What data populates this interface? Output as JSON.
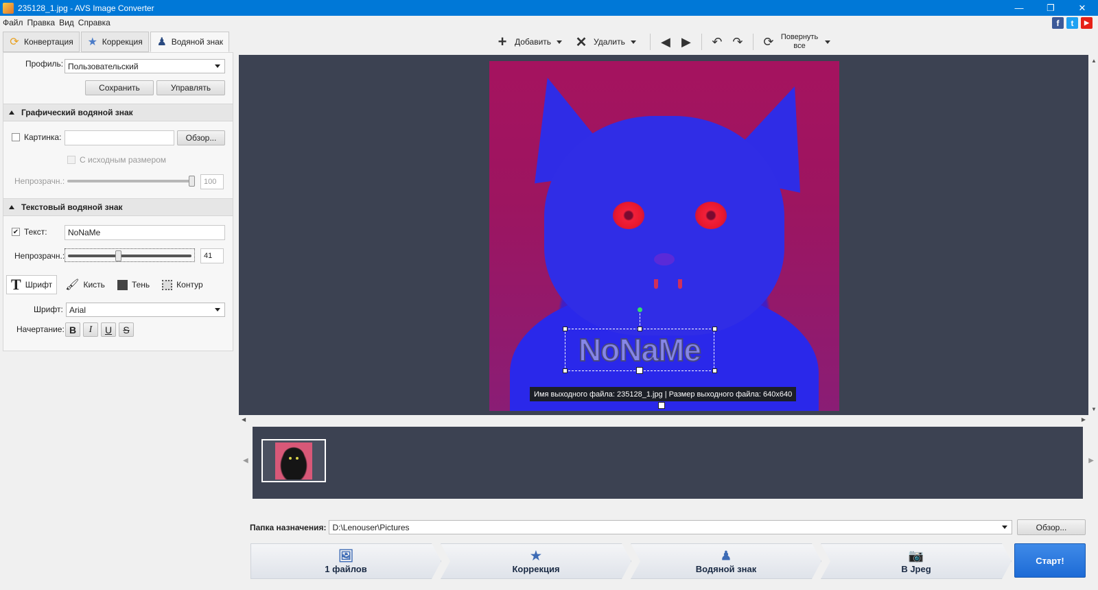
{
  "window": {
    "title": "235128_1.jpg - AVS Image Converter",
    "controls": [
      "—",
      "❐",
      "✕"
    ]
  },
  "menu": [
    "Файл",
    "Правка",
    "Вид",
    "Справка"
  ],
  "social": [
    {
      "name": "facebook",
      "glyph": "f",
      "color": "#3b5998"
    },
    {
      "name": "twitter",
      "glyph": "t",
      "color": "#1da1f2"
    },
    {
      "name": "youtube",
      "glyph": "▶",
      "color": "#e62117"
    }
  ],
  "tabs": [
    {
      "label": "Конвертация",
      "icon": "convert-icon"
    },
    {
      "label": "Коррекция",
      "icon": "star-icon"
    },
    {
      "label": "Водяной знак",
      "icon": "stamp-icon",
      "active": true
    }
  ],
  "profile": {
    "label": "Профиль:",
    "value": "Пользовательский",
    "save": "Сохранить",
    "manage": "Управлять"
  },
  "graphic_watermark": {
    "title": "Графический водяной знак",
    "picture_label": "Картинка:",
    "picture_value": "",
    "browse": "Обзор...",
    "original_size": "С исходным размером",
    "opacity_label": "Непрозрачн.:",
    "opacity_value": "100",
    "opacity": 1.0
  },
  "text_watermark": {
    "title": "Текстовый водяной знак",
    "text_label": "Текст:",
    "text_value": "NoNaMe",
    "checked": true,
    "opacity_label": "Непрозрачн.:",
    "opacity_value": "41",
    "opacity": 0.41,
    "style_tabs": [
      {
        "label": "Шрифт",
        "icon": "font-icon",
        "active": true
      },
      {
        "label": "Кисть",
        "icon": "brush-icon"
      },
      {
        "label": "Тень",
        "icon": "shadow-icon"
      },
      {
        "label": "Контур",
        "icon": "outline-icon"
      }
    ],
    "font_label": "Шрифт:",
    "font_value": "Arial",
    "style_label": "Начертание:",
    "style_buttons": [
      "B",
      "I",
      "U",
      "S"
    ]
  },
  "toolbar": {
    "add": "Добавить",
    "delete": "Удалить",
    "rotate_all_line1": "Повернуть",
    "rotate_all_line2": "все"
  },
  "preview": {
    "watermark_text": "NoNaMe",
    "tooltip": "Имя выходного файла: 235128_1.jpg | Размер выходного файла: 640x640"
  },
  "destination": {
    "label": "Папка назначения:",
    "path": "D:\\Lenouser\\Pictures",
    "browse": "Обзор..."
  },
  "steps": [
    {
      "label": "1 файлов",
      "icon": "files-icon"
    },
    {
      "label": "Коррекция",
      "icon": "star-icon"
    },
    {
      "label": "Водяной знак",
      "icon": "stamp-icon"
    },
    {
      "label": "В Jpeg",
      "icon": "jpeg-icon"
    }
  ],
  "start": "Старт!"
}
